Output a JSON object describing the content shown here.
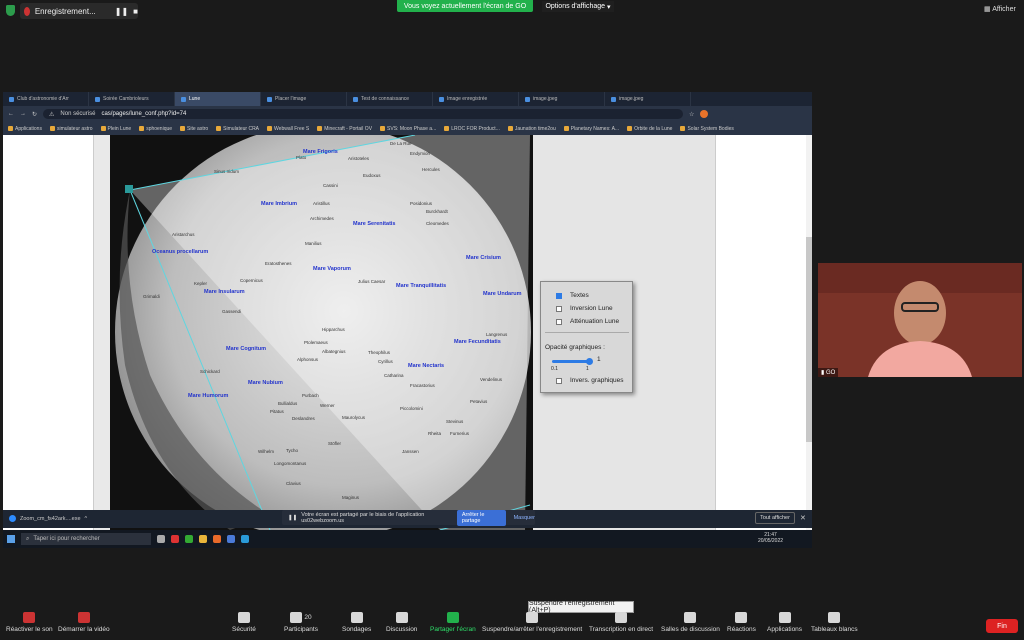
{
  "zoom_top": {
    "recording": "Enregistrement...",
    "share_banner": "Vous voyez actuellement l'écran de GO",
    "view_options": "Options d'affichage",
    "show": "Afficher"
  },
  "browser": {
    "tabs": [
      "Club d'astronomie d'Arr",
      "Soirée Cambrioleurs",
      "Lune",
      "Placer l'image",
      "Test de connaissance",
      "Image enregistrée",
      "image.jpeg",
      "image.jpeg"
    ],
    "not_secure": "Non sécurisé",
    "url": "cas/pages/lune_conf.php?id=74",
    "bookmarks": [
      "Applications",
      "simulateur astro",
      "Plein Lune",
      "sphoenique",
      "Site astro",
      "Simulateur CRA",
      "Webwall Free S",
      "Minecraft - Portail OV",
      "SVS: Moon Phase a...",
      "LROC FOR Product...",
      "Jaunation time2ou",
      "Planetary Names: A...",
      "Orbite de la Lune",
      "Solar System Bodies"
    ]
  },
  "moon_panel": {
    "textes": "Textes",
    "inversion": "Inversion Lune",
    "attenuation": "Atténuation Lune",
    "opacity_label": "Opacité graphiques :",
    "opacity_value": "1",
    "opacity_min": "0.1",
    "opacity_max": "1",
    "invers": "Invers. graphiques",
    "opacity_level": 1
  },
  "moon_labels_blue": [
    "Mare Frigoris",
    "Mare Imbrium",
    "Mare Serenitatis",
    "Mare Crisium",
    "Oceanus procellarum",
    "Mare Vaporum",
    "Mare Tranquillitatis",
    "Mare Undarum",
    "Mare Insularum",
    "Mare Fecunditatis",
    "Mare Cognitum",
    "Mare Nectaris",
    "Mare Nubium",
    "Mare Humorum"
  ],
  "moon_labels_dark": [
    "De La Rue",
    "Plato",
    "Aristoteles",
    "Endymion",
    "Sinus Iridum",
    "Eudoxus",
    "Hercules",
    "Cassini",
    "Posidonius",
    "Aristillus",
    "Burckhardt",
    "Archimedes",
    "Cleomedes",
    "Aristarchus",
    "Manilius",
    "Eratosthenes",
    "Julius Caesar",
    "Copernicus",
    "Kepler",
    "Hipparchus",
    "Ptolemaeus",
    "Albategnius",
    "Theophilus",
    "Cyrillus",
    "Catharina",
    "Alphonsus",
    "Fracastorius",
    "Pitatus",
    "Werner",
    "Piccolomini",
    "Rheita",
    "Deslandres",
    "Maurolycus",
    "Stöfler",
    "Tycho",
    "Wilhelm",
    "Longomontanus",
    "Clavius",
    "Maginus",
    "Vendelinus",
    "Petavius",
    "Furnerius",
    "Stevinus",
    "Gassendi",
    "Schickard",
    "Grimaldi",
    "Langrenus",
    "Bullialdus",
    "Purbach",
    "Janssen"
  ],
  "notify": {
    "text": "Votre écran est partagé par le biais de l'application us02webzoom.us",
    "stop": "Arrêter le partage",
    "hide": "Masquer"
  },
  "download": {
    "file": "Zoom_cm_fs42ark....exe",
    "show_all": "Tout afficher"
  },
  "win_taskbar": {
    "search": "Taper ici pour rechercher",
    "time": "21:47",
    "date": "20/05/2022"
  },
  "cam": {
    "name": "GO"
  },
  "tooltip": "Suspendre l'enregistrement (Alt+P)",
  "toolbar": {
    "unmute": "Réactiver le son",
    "video": "Démarrer la vidéo",
    "security": "Sécurité",
    "participants": "Participants",
    "participants_count": "20",
    "polls": "Sondages",
    "chat": "Discussion",
    "share": "Partager l'écran",
    "pause_rec": "Suspendre/arrêter l'enregistrement",
    "transcript": "Transcription en direct",
    "breakout": "Salles de discussion",
    "reactions": "Réactions",
    "apps": "Applications",
    "whiteboard": "Tableaux blancs",
    "end": "Fin"
  }
}
